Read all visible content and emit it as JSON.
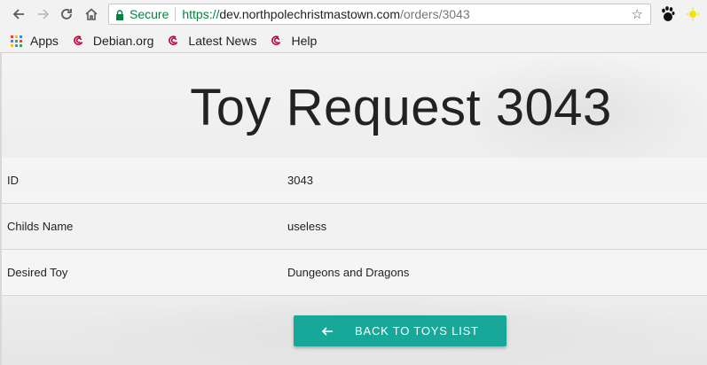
{
  "browser": {
    "secure_label": "Secure",
    "url_scheme": "https://",
    "url_host": "dev.northpolechristmastown.com",
    "url_path": "/orders/3043",
    "icons": {
      "back": "arrow-left-icon",
      "forward": "arrow-right-icon",
      "reload": "reload-icon",
      "home": "home-icon",
      "lock": "lock-icon",
      "star": "star-icon"
    }
  },
  "bookmarks": [
    {
      "label": "Apps",
      "icon": "apps-grid-icon"
    },
    {
      "label": "Debian.org",
      "icon": "debian-swirl-icon"
    },
    {
      "label": "Latest News",
      "icon": "debian-swirl-icon"
    },
    {
      "label": "Help",
      "icon": "debian-swirl-icon"
    }
  ],
  "page": {
    "title": "Toy Request 3043",
    "rows": [
      {
        "label": "ID",
        "value": "3043"
      },
      {
        "label": "Childs Name",
        "value": "useless"
      },
      {
        "label": "Desired Toy",
        "value": "Dungeons and Dragons"
      }
    ],
    "back_button": "BACK TO TOYS LIST",
    "accent_color": "#17a899"
  }
}
